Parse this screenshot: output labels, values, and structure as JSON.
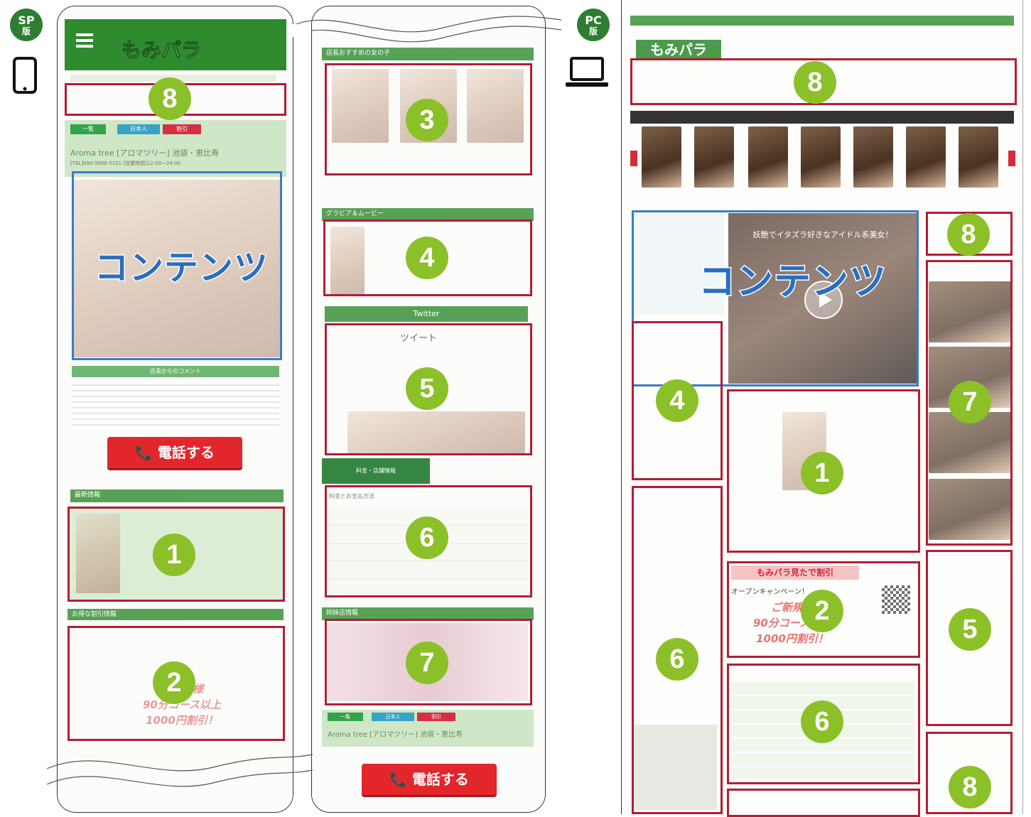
{
  "sp": {
    "badge_line1": "SP",
    "badge_line2": "版"
  },
  "pc": {
    "badge_line1": "PC",
    "badge_line2": "版"
  },
  "labels": {
    "contents": "コンテンツ",
    "call_button": "📞 電話する",
    "campaign_line1": "ご新規様",
    "campaign_line2": "90分コース以上",
    "campaign_line3": "1000円割引！",
    "pc_campaign_title": "もみパラ見たで割引",
    "pc_campaign_sub": "オープンキャンペーン！",
    "pc_video_caption": "妖艶でイタズラ好きなアイドル系美女！",
    "tweet": "ツイート",
    "twitter": "Twitter",
    "sp_logo": "もみパラ",
    "shop_name": "Aroma tree [アロマツリー] 池袋・恵比寿",
    "shop_tel": "[TEL]090-5808-5151 [営業時間]12:00～24:00",
    "comment_header": "店長からのコメント",
    "news_header": "最新情報",
    "discount_header": "お得な割引情報",
    "recommend_header": "店長おすすめの女の子",
    "gravure_header": "グラビア＆ムービー",
    "price_tab": "料金・店舗情報",
    "price_header": "料金とお支払方法",
    "sister_header": "姉妹店情報",
    "nav_tabs": [
      "一覧",
      "日本人",
      "割引"
    ]
  },
  "numbers": [
    "1",
    "2",
    "3",
    "4",
    "5",
    "6",
    "7",
    "8"
  ],
  "colors": {
    "red": "#b21e35",
    "blue": "#3a7cc4",
    "num_green": "#8cc028",
    "badge_green": "#2f7d32"
  }
}
